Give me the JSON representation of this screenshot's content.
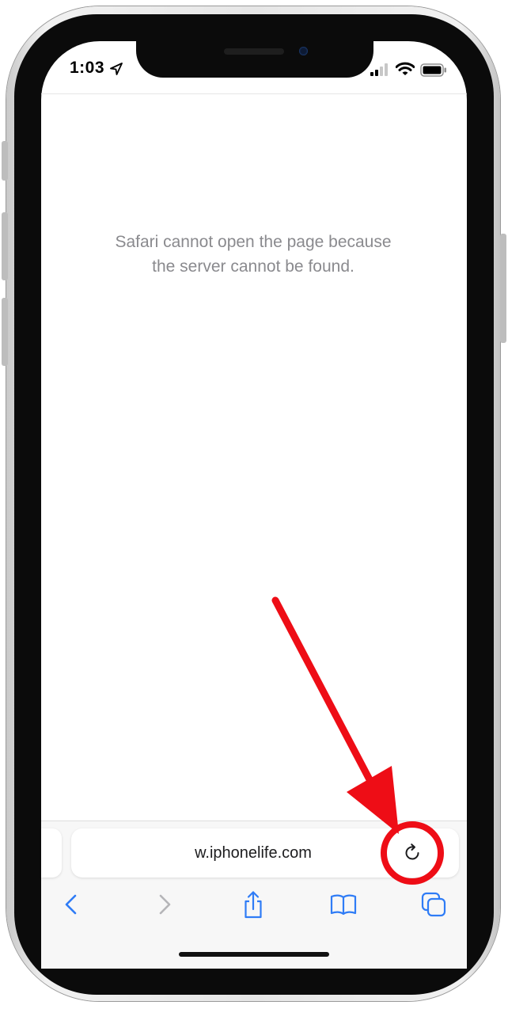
{
  "status_bar": {
    "time": "1:03",
    "icons": [
      "location-arrow-icon",
      "cellular-signal-icon",
      "wifi-icon",
      "battery-icon"
    ]
  },
  "page": {
    "error_line1": "Safari cannot open the page because",
    "error_line2": "the server cannot be found."
  },
  "address_bar": {
    "url": "w.iphonelife.com",
    "reload_icon": "reload-icon"
  },
  "toolbar": {
    "items": [
      "back-chevron-icon",
      "forward-chevron-icon",
      "share-icon",
      "bookmarks-book-icon",
      "tabs-icon"
    ]
  },
  "colors": {
    "accent": "#2f7cf6",
    "annotation_red": "#ee0d16",
    "message_gray": "#8a8a8e"
  }
}
